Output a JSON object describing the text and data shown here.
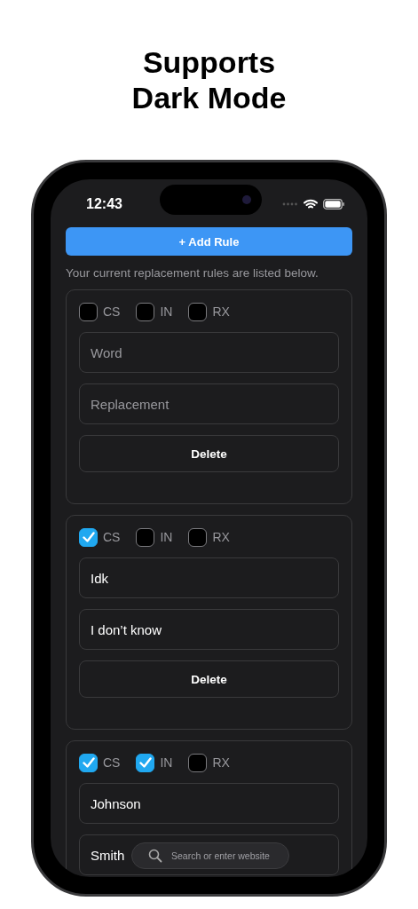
{
  "headline": [
    "Supports",
    "Dark Mode"
  ],
  "status_bar": {
    "time": "12:43"
  },
  "add_button": "+ Add Rule",
  "caption": "Your current replacement rules are listed below.",
  "rules": [
    {
      "options": [
        {
          "label": "CS",
          "checked": false
        },
        {
          "label": "IN",
          "checked": false
        },
        {
          "label": "RX",
          "checked": false
        }
      ],
      "word": {
        "placeholder": "Word"
      },
      "replacement": {
        "placeholder": "Replacement"
      },
      "delete": "Delete"
    },
    {
      "options": [
        {
          "label": "CS",
          "checked": true
        },
        {
          "label": "IN",
          "checked": false
        },
        {
          "label": "RX",
          "checked": false
        }
      ],
      "word": {
        "value": "Idk"
      },
      "replacement": {
        "value": "I don’t know"
      },
      "delete": "Delete"
    },
    {
      "options": [
        {
          "label": "CS",
          "checked": true
        },
        {
          "label": "IN",
          "checked": true
        },
        {
          "label": "RX",
          "checked": false
        }
      ],
      "word": {
        "value": "Johnson"
      },
      "replacement": {
        "value": "Smith"
      }
    }
  ],
  "browser_search": {
    "placeholder": "Search or enter website"
  }
}
